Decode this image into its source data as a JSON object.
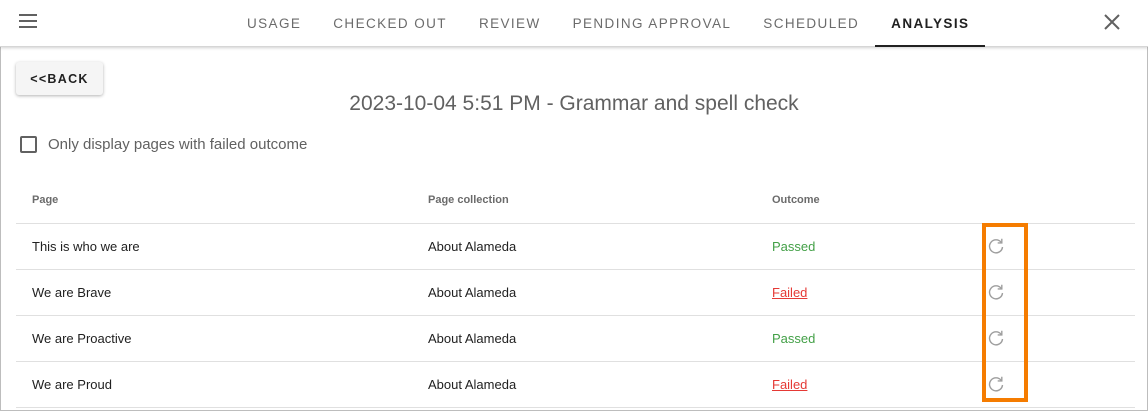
{
  "nav": {
    "menu_icon": "hamburger-menu-icon",
    "tabs": [
      {
        "label": "USAGE"
      },
      {
        "label": "CHECKED OUT"
      },
      {
        "label": "REVIEW"
      },
      {
        "label": "PENDING APPROVAL"
      },
      {
        "label": "SCHEDULED"
      },
      {
        "label": "ANALYSIS"
      }
    ],
    "active_tab": "ANALYSIS",
    "close_icon": "close-icon"
  },
  "back_button": "<<BACK",
  "page_title": "2023-10-04 5:51 PM - Grammar and spell check",
  "filter": {
    "label": "Only display pages with failed outcome",
    "checked": false
  },
  "table": {
    "headers": [
      "Page",
      "Page collection",
      "Outcome"
    ],
    "rows": [
      {
        "page": "This is who we are",
        "collection": "About Alameda",
        "outcome": "Passed"
      },
      {
        "page": "We are Brave",
        "collection": "About Alameda",
        "outcome": "Failed"
      },
      {
        "page": "We are Proactive",
        "collection": "About Alameda",
        "outcome": "Passed"
      },
      {
        "page": "We are Proud",
        "collection": "About Alameda",
        "outcome": "Failed"
      }
    ],
    "row_action_icon": "refresh-icon"
  },
  "colors": {
    "passed": "#43a047",
    "failed": "#e53935",
    "highlight": "#f57c00"
  }
}
